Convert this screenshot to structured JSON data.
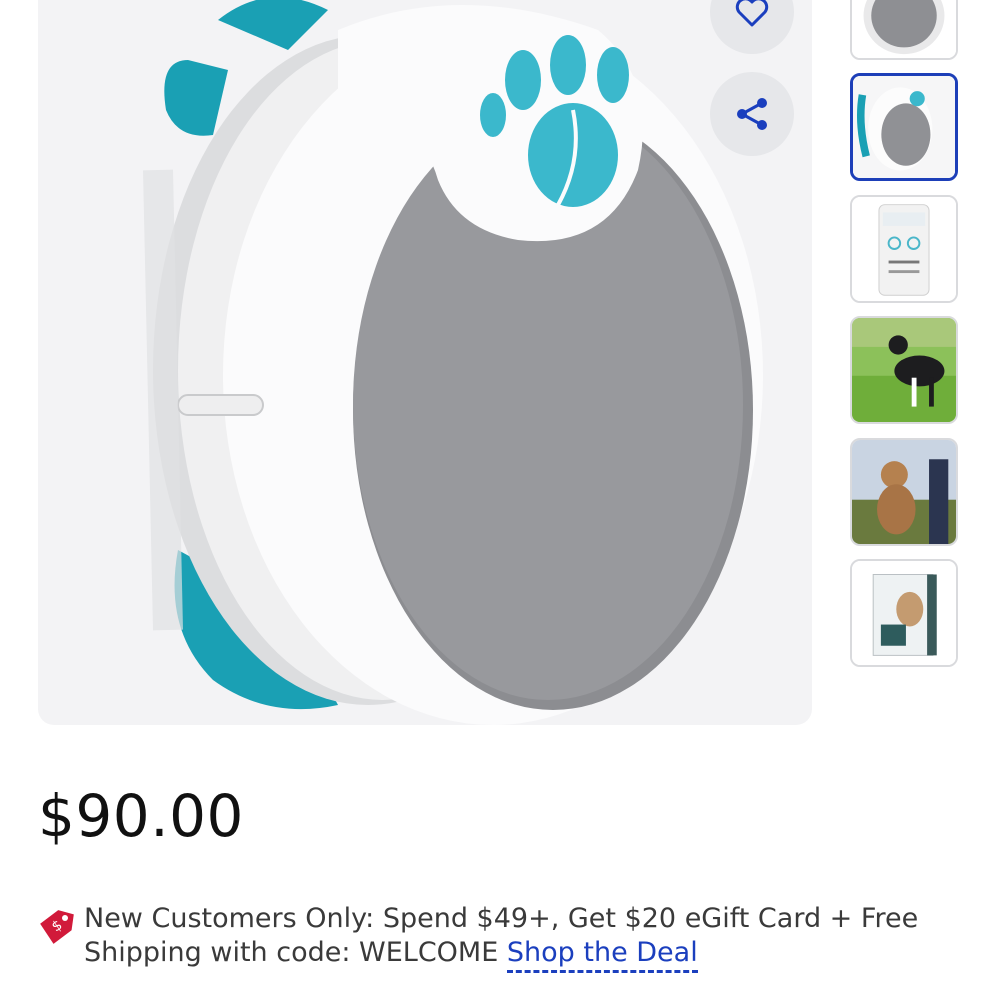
{
  "product": {
    "price": "$90.00",
    "image_alt": "Pet activity tracker with blue paw print",
    "gallery": [
      {
        "kind": "device-front"
      },
      {
        "kind": "device-side",
        "selected": true
      },
      {
        "kind": "phone-app"
      },
      {
        "kind": "dog-field"
      },
      {
        "kind": "dog-owner"
      },
      {
        "kind": "product-box"
      }
    ]
  },
  "actions": {
    "favorite_icon": "heart-icon",
    "share_icon": "share-icon"
  },
  "promo": {
    "icon": "tag-icon",
    "text": "New Customers Only: Spend $49+, Get $20 eGift Card + Free Shipping with code: WELCOME",
    "link_label": "Shop the Deal"
  },
  "colors": {
    "link": "#1b3fbe",
    "selected_border": "#1d3fb8",
    "badge": "#d11a3a",
    "paw": "#3bb8cc",
    "strap": "#1aa0b4"
  }
}
